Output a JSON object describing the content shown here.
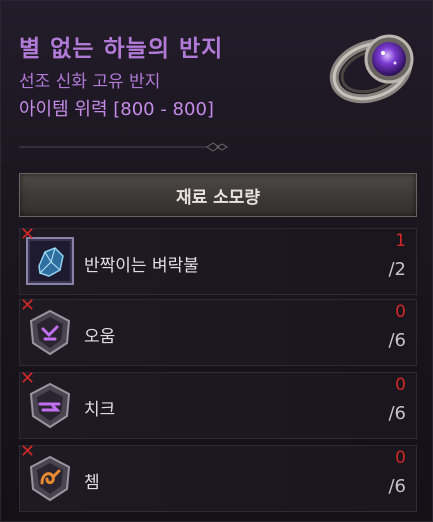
{
  "item": {
    "title": "별 없는 하늘의 반지",
    "subtitle": "선조 신화 고유 반지",
    "power": "아이템 위력 [800 - 800]"
  },
  "materials_header": "재료 소모량",
  "materials": [
    {
      "name": "반짝이는 벼락불",
      "have": "1",
      "need": "/2",
      "icon": "crystal-icon"
    },
    {
      "name": "오움",
      "have": "0",
      "need": "/6",
      "icon": "rune-oum-icon"
    },
    {
      "name": "치크",
      "have": "0",
      "need": "/6",
      "icon": "rune-chik-icon"
    },
    {
      "name": "쳄",
      "have": "0",
      "need": "/6",
      "icon": "rune-chem-icon"
    }
  ],
  "colors": {
    "title": "#b07ad6",
    "missing": "#d02828"
  }
}
